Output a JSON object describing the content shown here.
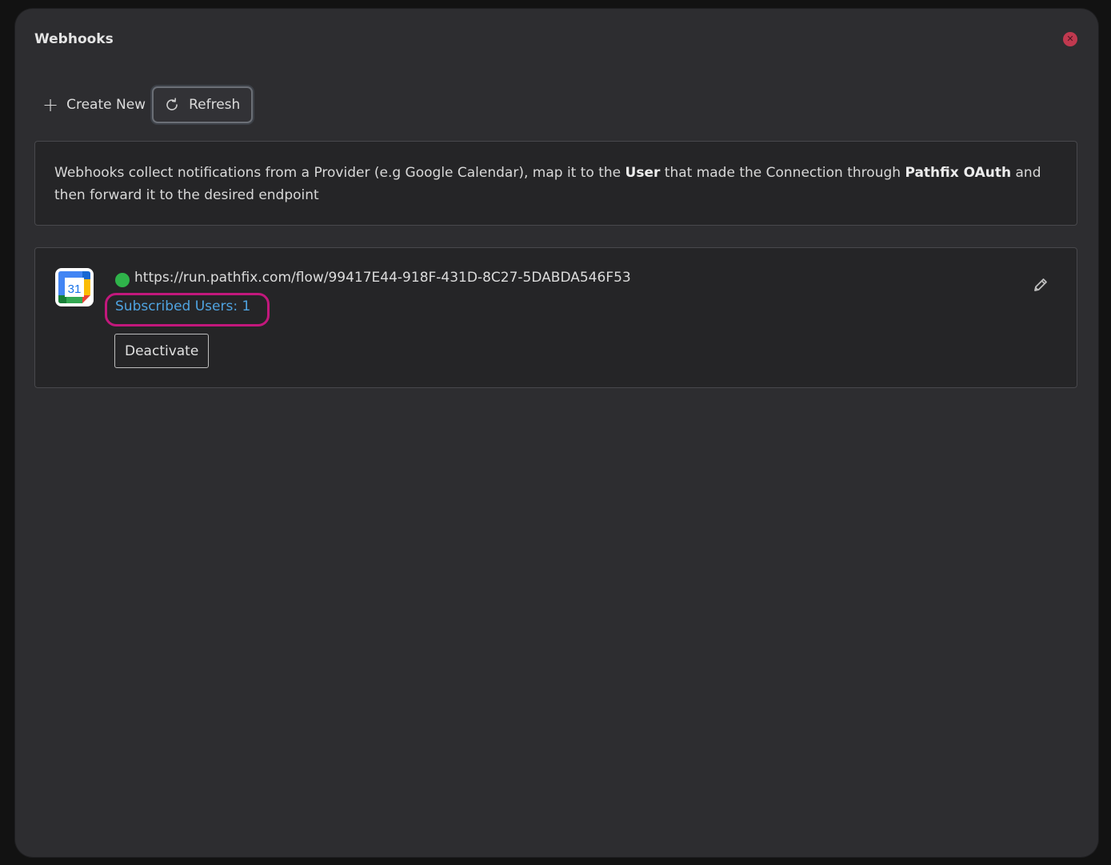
{
  "dialog": {
    "title": "Webhooks",
    "close_icon": "close-icon"
  },
  "toolbar": {
    "create_label": "Create New",
    "create_icon": "plus-icon",
    "refresh_label": "Refresh",
    "refresh_icon": "refresh-icon"
  },
  "info": {
    "text_1": "Webhooks collect notifications from a Provider (e.g Google Calendar), map it to the ",
    "bold_1": "User",
    "text_2": " that made the Connection through ",
    "bold_2": "Pathfix OAuth",
    "text_3": " and then forward it to the desired endpoint"
  },
  "webhooks": [
    {
      "provider_icon": "google-calendar-icon",
      "provider_icon_day": "31",
      "status": "active",
      "status_color": "#2fb34a",
      "url": "https://run.pathfix.com/flow/99417E44-918F-431D-8C27-5DABDA546F53",
      "subscribed_users": "Subscribed Users: 1",
      "deactivate_label": "Deactivate",
      "edit_icon": "pencil-icon"
    }
  ],
  "colors": {
    "highlight": "#c2187c",
    "link": "#4fa3e0",
    "close": "#c0394f"
  }
}
